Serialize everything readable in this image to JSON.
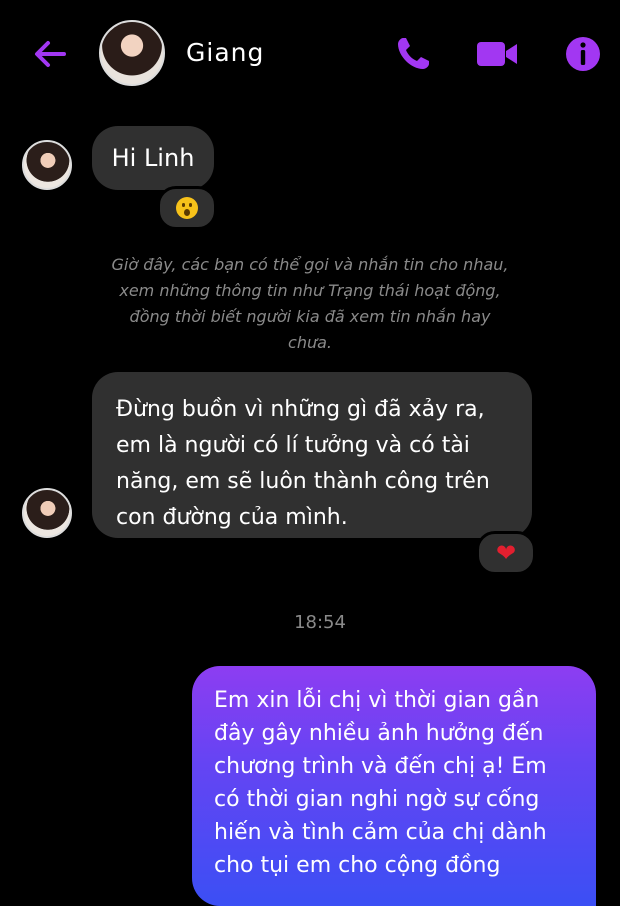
{
  "header": {
    "contact_name": "Giang",
    "accent_color": "#a237f2",
    "icons": [
      "back-arrow-icon",
      "phone-icon",
      "video-camera-icon",
      "info-icon"
    ]
  },
  "messages": [
    {
      "id": "m1",
      "direction": "incoming",
      "text": "Hi Linh",
      "reaction": "astonished-face"
    },
    {
      "id": "m2",
      "direction": "incoming",
      "text_lines": [
        "Đừng buồn vì những gì đã xảy ra,",
        "em là người có lí tưởng và có tài",
        "năng, em sẽ luôn thành công trên",
        "con đường của mình."
      ],
      "reaction": "red-heart"
    },
    {
      "id": "m3",
      "direction": "outgoing",
      "text_lines": [
        "Em xin lỗi chị vì thời gian gần",
        "đây gây nhiều ảnh hưởng đến",
        "chương trình và đến chị ạ! Em",
        "có thời gian nghi ngờ sự cống",
        "hiến và tình cảm của chị dành",
        "cho tụi em cho cộng đồng"
      ]
    }
  ],
  "notice": {
    "lines": [
      "Giờ đây, các bạn có thể gọi và nhắn tin cho nhau,",
      "xem những thông tin như Trạng thái hoạt động,",
      "đồng thời biết người kia đã xem tin nhắn hay",
      "chưa."
    ]
  },
  "timestamp": "18:54",
  "colors": {
    "incoming_bubble": "#303030",
    "outgoing_gradient_top": "#8d3df2",
    "outgoing_gradient_bottom": "#3b4ff4",
    "muted_text": "#8a8a8a"
  }
}
